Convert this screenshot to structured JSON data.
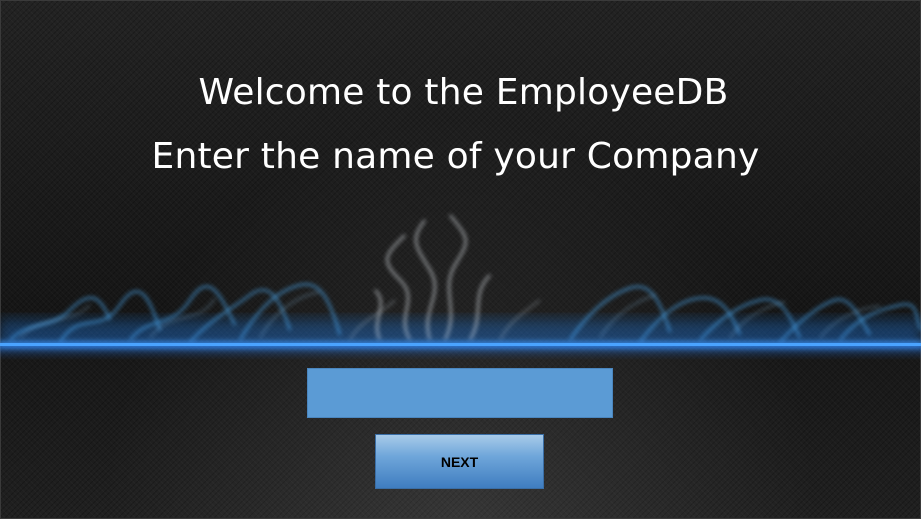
{
  "welcome": {
    "line1": "Welcome to the EmployeeDB",
    "line2": "Enter the name of your Company"
  },
  "form": {
    "company_name_value": "",
    "next_label": "NEXT"
  },
  "colors": {
    "background": "#1d1d1d",
    "glow_line": "#4aa3ff",
    "input_fill": "#5b9bd5",
    "button_fill": "#5b9bd5",
    "title_text": "#ffffff"
  },
  "icons": {
    "decoration": "blue-smoke-glow"
  }
}
